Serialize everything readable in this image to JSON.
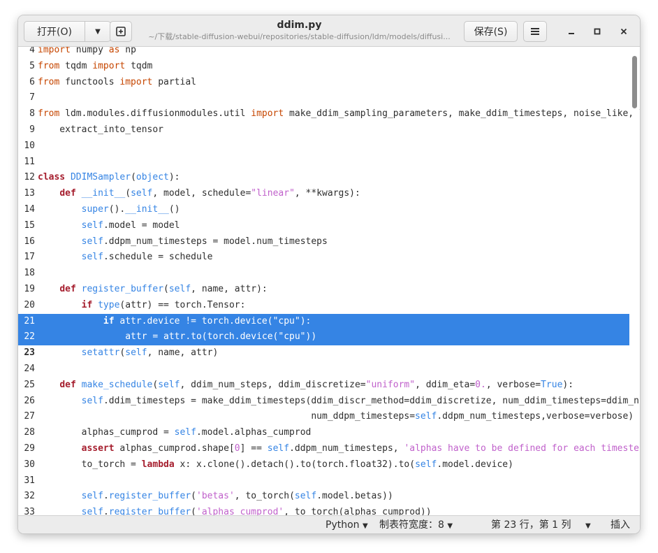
{
  "header": {
    "open_label": "打开(O)",
    "save_label": "保存(S)",
    "title": "ddim.py",
    "path": "~/下载/stable-diffusion-webui/repositories/stable-diffusion/ldm/models/diffusi..."
  },
  "editor": {
    "current_line": 23,
    "selected_lines": [
      21,
      22
    ],
    "lines": [
      {
        "n": "4",
        "code": "import numpy as np"
      },
      {
        "n": "5",
        "code": "from tqdm import tqdm"
      },
      {
        "n": "6",
        "code": "from functools import partial"
      },
      {
        "n": "7",
        "code": ""
      },
      {
        "n": "8",
        "code": "from ldm.modules.diffusionmodules.util import make_ddim_sampling_parameters, make_ddim_timesteps, noise_like, \\"
      },
      {
        "n": "9",
        "code": "    extract_into_tensor"
      },
      {
        "n": "10",
        "code": ""
      },
      {
        "n": "11",
        "code": ""
      },
      {
        "n": "12",
        "code": "class DDIMSampler(object):"
      },
      {
        "n": "13",
        "code": "    def __init__(self, model, schedule=\"linear\", **kwargs):"
      },
      {
        "n": "14",
        "code": "        super().__init__()"
      },
      {
        "n": "15",
        "code": "        self.model = model"
      },
      {
        "n": "16",
        "code": "        self.ddpm_num_timesteps = model.num_timesteps"
      },
      {
        "n": "17",
        "code": "        self.schedule = schedule"
      },
      {
        "n": "18",
        "code": ""
      },
      {
        "n": "19",
        "code": "    def register_buffer(self, name, attr):"
      },
      {
        "n": "20",
        "code": "        if type(attr) == torch.Tensor:"
      },
      {
        "n": "21",
        "code": "            if attr.device != torch.device(\"cpu\"):"
      },
      {
        "n": "22",
        "code": "                attr = attr.to(torch.device(\"cpu\"))"
      },
      {
        "n": "23",
        "code": "        setattr(self, name, attr)"
      },
      {
        "n": "24",
        "code": ""
      },
      {
        "n": "25",
        "code": "    def make_schedule(self, ddim_num_steps, ddim_discretize=\"uniform\", ddim_eta=0., verbose=True):"
      },
      {
        "n": "26",
        "code": "        self.ddim_timesteps = make_ddim_timesteps(ddim_discr_method=ddim_discretize, num_ddim_timesteps=ddim_num_steps,"
      },
      {
        "n": "27",
        "code": "                                                  num_ddpm_timesteps=self.ddpm_num_timesteps,verbose=verbose)"
      },
      {
        "n": "28",
        "code": "        alphas_cumprod = self.model.alphas_cumprod"
      },
      {
        "n": "29",
        "code": "        assert alphas_cumprod.shape[0] == self.ddpm_num_timesteps, 'alphas have to be defined for each timestep'"
      },
      {
        "n": "30",
        "code": "        to_torch = lambda x: x.clone().detach().to(torch.float32).to(self.model.device)"
      },
      {
        "n": "31",
        "code": ""
      },
      {
        "n": "32",
        "code": "        self.register_buffer('betas', to_torch(self.model.betas))"
      },
      {
        "n": "33",
        "code": "        self.register_buffer('alphas_cumprod', to_torch(alphas_cumprod))"
      }
    ]
  },
  "statusbar": {
    "language": "Python",
    "tab_width": "制表符宽度：8",
    "position": "第 23 行，第 1 列",
    "insert_mode": "插入"
  },
  "icons": {
    "dropdown": "chevron-down-icon",
    "new_tab": "new-document-icon",
    "menu": "hamburger-menu-icon",
    "minimize": "minimize-icon",
    "maximize": "maximize-icon",
    "close": "close-icon"
  },
  "colors": {
    "selection": "#3584e4",
    "keyword": "#a51d2d",
    "string": "#c061cb",
    "builtin": "#3584e4"
  }
}
